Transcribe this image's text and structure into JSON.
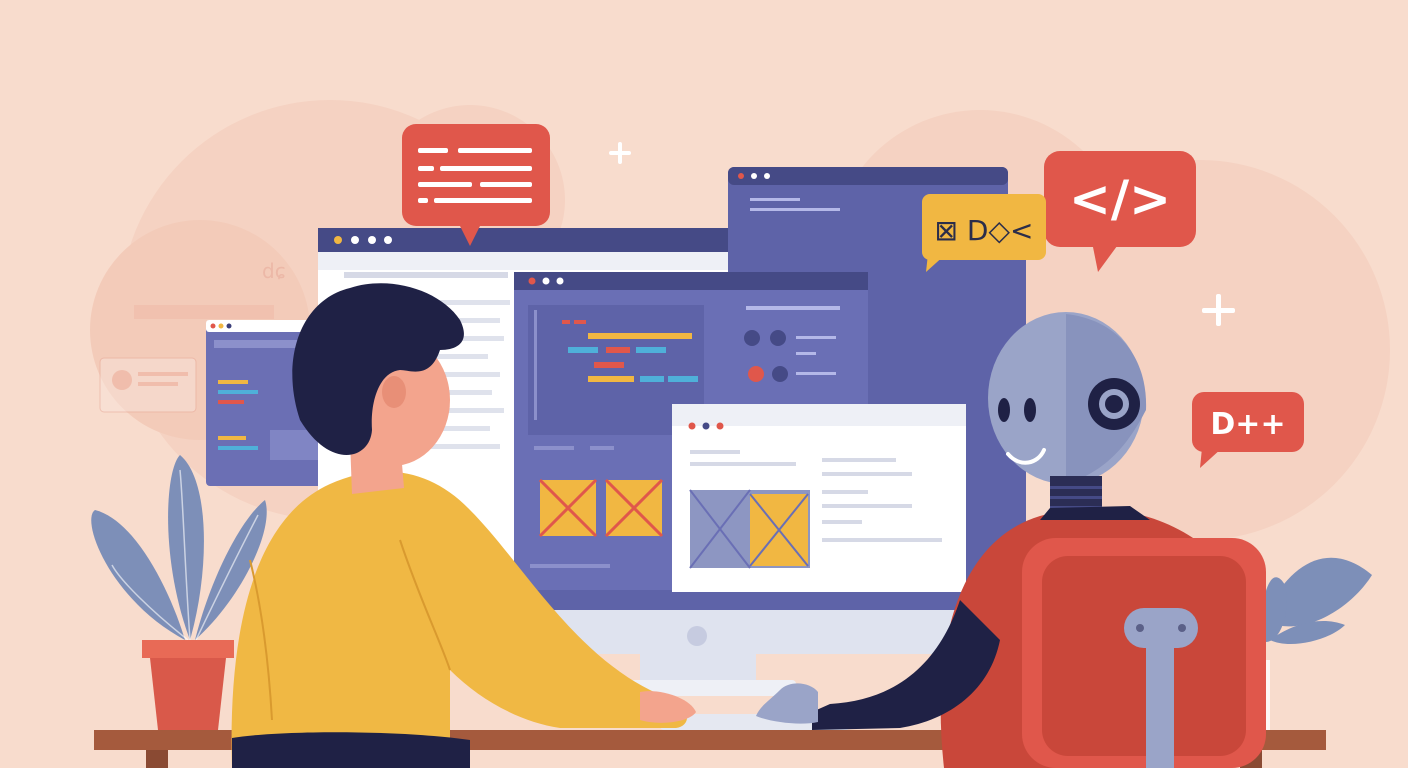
{
  "scene": {
    "description_visible_text": {
      "code_bubble": "</>",
      "symbol_bubble": "⊠ D◇<",
      "language_bubble": "D++"
    },
    "colors": {
      "background": "#f8dccd",
      "monitor_frame": "#5e63a8",
      "window_header": "#4a4f86",
      "panel_purple": "#6a6fb5",
      "bubble_red": "#e0574b",
      "bubble_yellow": "#f1b742",
      "sweater_yellow": "#f0b844",
      "robot_red": "#c9473a",
      "robot_gray": "#9aa4c8",
      "hair_navy": "#1f2145",
      "desk_brown": "#a55a3d",
      "plant_blue": "#7d8fb8",
      "pot_red": "#d9594a"
    },
    "icons": [
      "code-brackets-icon",
      "plus-sparkle-icon",
      "text-lines-icon",
      "headphone-ear-icon"
    ]
  }
}
